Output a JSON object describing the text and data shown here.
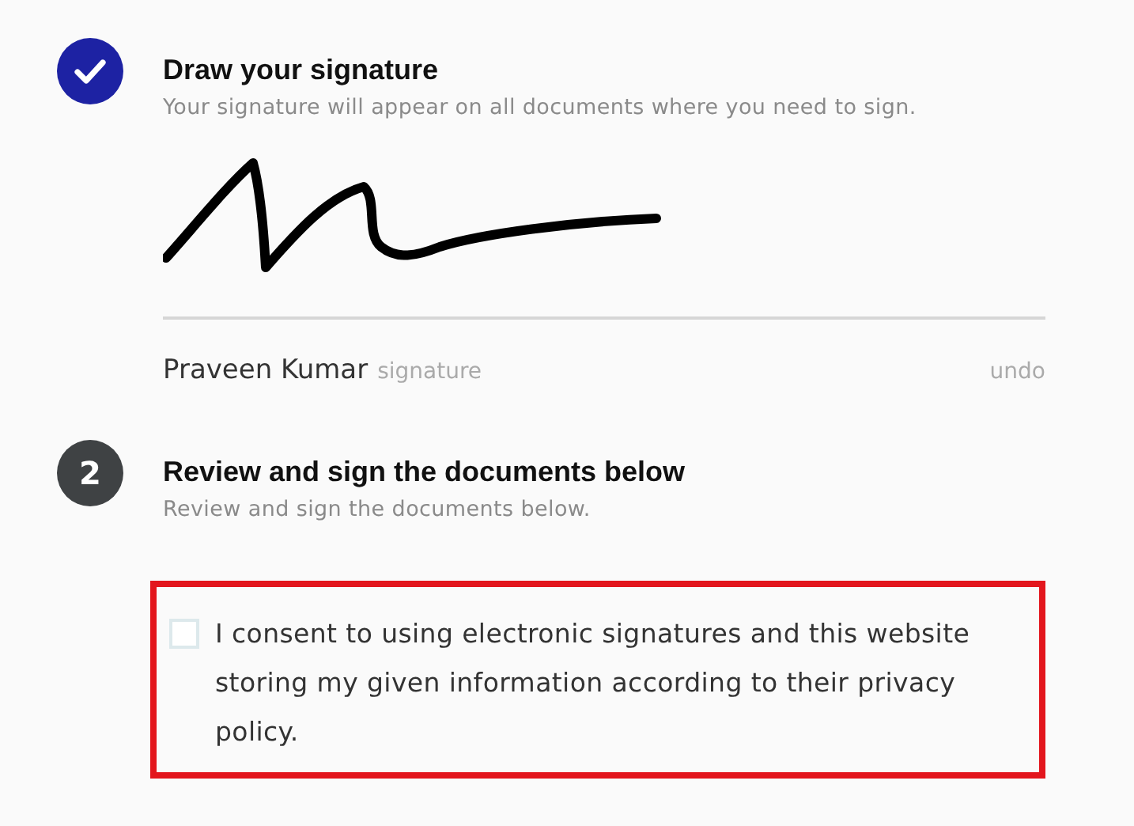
{
  "steps": [
    {
      "completed": true,
      "title": "Draw your signature",
      "subtitle": "Your signature will appear on all documents where you need to sign.",
      "signature": {
        "name": "Praveen Kumar",
        "label": "signature",
        "action": "undo"
      }
    },
    {
      "completed": false,
      "number": "2",
      "title": "Review and sign the documents below",
      "subtitle": "Review and sign the documents below.",
      "consent": {
        "checked": false,
        "highlighted": true,
        "text": "I consent to using electronic signatures and this website storing my given information according to their privacy policy."
      }
    }
  ]
}
